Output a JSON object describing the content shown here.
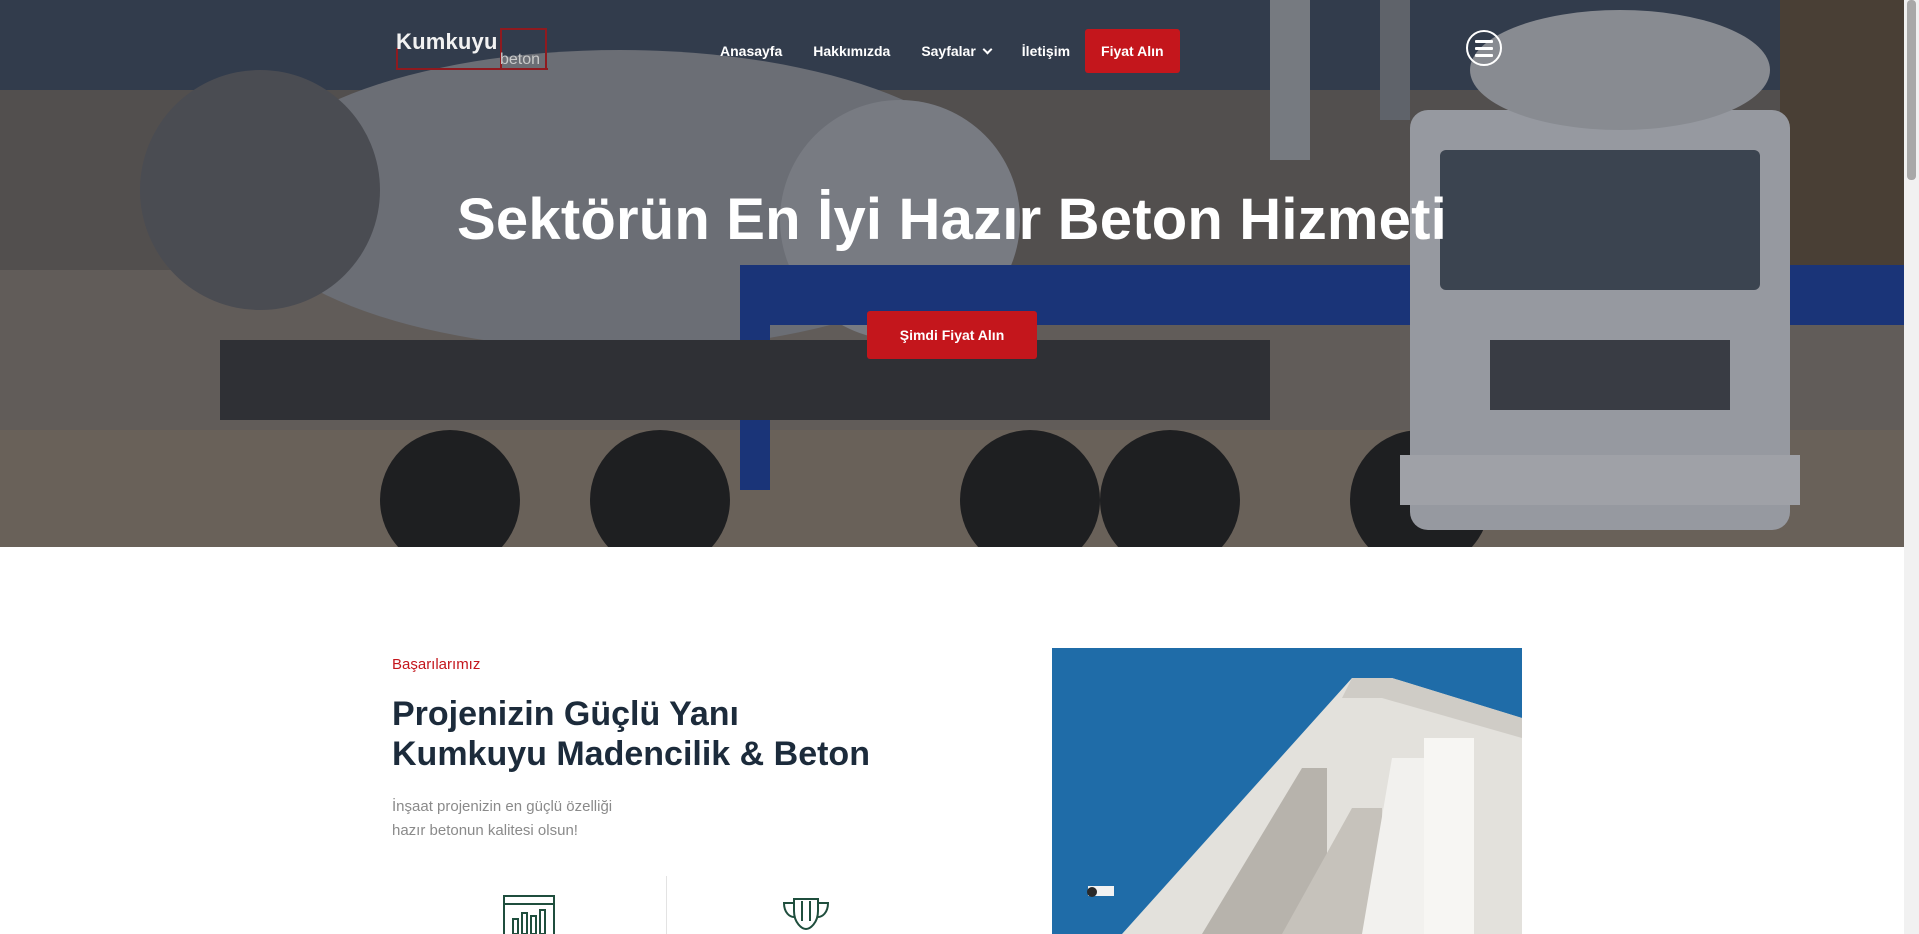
{
  "header": {
    "logo": {
      "word1": "Kumkuyu",
      "word2": "beton"
    },
    "nav": [
      {
        "label": "Anasayfa"
      },
      {
        "label": "Hakkımızda"
      },
      {
        "label": "Sayfalar"
      },
      {
        "label": "İletişim"
      }
    ],
    "cta_label": "Fiyat Alın",
    "menu_icon": "hamburger-icon"
  },
  "hero": {
    "title": "Sektörün En İyi Hazır Beton Hizmeti",
    "cta_label": "Şimdi Fiyat Alın"
  },
  "section": {
    "kicker": "Başarılarımız",
    "title_line1": "Projenizin Güçlü Yanı",
    "title_line2": "Kumkuyu Madencilik & Beton",
    "text_line1": "İnşaat projenizin en güçlü özelliği",
    "text_line2": "hazır betonun kalitesi olsun!",
    "feature_icons": [
      "chart-icon",
      "trophy-icon"
    ]
  },
  "colors": {
    "accent": "#c4161c",
    "heading": "#1c2b3b",
    "text_muted": "#8a8a8a"
  }
}
